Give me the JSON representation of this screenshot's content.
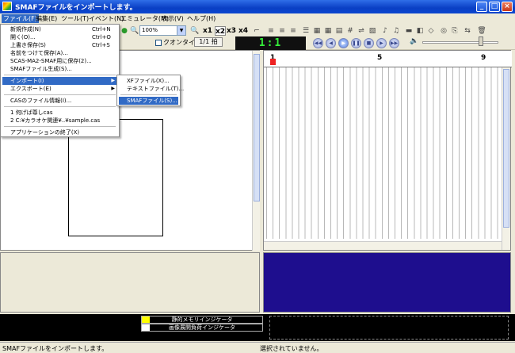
{
  "window": {
    "title": "SMAFファイルをインポートします。"
  },
  "menubar": {
    "items": [
      {
        "label": "ファイル(F)",
        "active": true
      },
      {
        "label": "編集(E)"
      },
      {
        "label": "ツール(T)"
      },
      {
        "label": "イベント(N)"
      },
      {
        "label": "エミュレータ(M)"
      },
      {
        "label": "表示(V)"
      },
      {
        "label": "ヘルプ(H)"
      }
    ]
  },
  "toolbar": {
    "zoom_value": "100%",
    "multipliers": [
      "x1",
      "x2",
      "x3",
      "x4"
    ],
    "quantize_label": "クオンタイズ",
    "beat_label": "1/1 拍",
    "position_display": "1:1"
  },
  "file_menu": {
    "items": [
      {
        "label": "新規作成(N)",
        "shortcut": "Ctrl+N"
      },
      {
        "label": "開く(O)...",
        "shortcut": "Ctrl+O"
      },
      {
        "label": "上書き保存(S)",
        "shortcut": "Ctrl+S"
      },
      {
        "label": "名前をつけて保存(A)..."
      },
      {
        "label": "SCAS-MA2-SMAF用に保存(2)..."
      },
      {
        "label": "SMAFファイル生成(S)..."
      },
      {
        "label": "インポート(I)",
        "highlighted": true
      },
      {
        "label": "エクスポート(E)"
      },
      {
        "label": "CASのファイル情報(I)..."
      },
      {
        "label": "1 何げば尊しcas"
      },
      {
        "label": "2 C:¥カラオケ関連¥..¥sample.cas"
      },
      {
        "label": "アプリケーションの終了(X)"
      }
    ]
  },
  "import_submenu": {
    "items": [
      {
        "label": "XFファイル(X)..."
      },
      {
        "label": "テキストファイル(T)..."
      },
      {
        "label": "SMAFファイル(S)...",
        "highlighted": true
      }
    ]
  },
  "ruler": {
    "marks": [
      "1",
      "5",
      "9"
    ]
  },
  "indicators": [
    {
      "label": "静的メモリインジケータ",
      "color": "#ffff00"
    },
    {
      "label": "画像展開負荷インジケータ",
      "color": "#ffffff"
    }
  ],
  "statusbar": {
    "left": "SMAFファイルをインポートします。",
    "right": "選択されていません。"
  },
  "colors": {
    "accent": "#316ac5",
    "lcd_text": "#35f03a",
    "lower_right_bg": "#1e0e8e"
  }
}
